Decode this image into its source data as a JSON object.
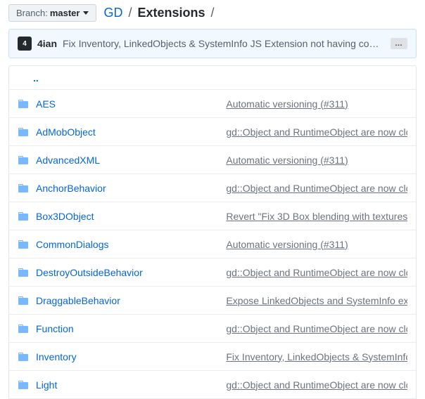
{
  "branch": {
    "label": "Branch:",
    "name": "master"
  },
  "breadcrumb": {
    "root": "GD",
    "current": "Extensions",
    "sep": "/"
  },
  "commit": {
    "author": "4ian",
    "avatar_letter": "4",
    "message": "Fix Inventory, LinkedObjects & SystemInfo JS Extension not having com…",
    "expand": "…"
  },
  "updir": "..",
  "files": [
    {
      "name": "AES",
      "msg": "Automatic versioning (#311)"
    },
    {
      "name": "AdMobObject",
      "msg": "gd::Object and RuntimeObject are now clo"
    },
    {
      "name": "AdvancedXML",
      "msg": "Automatic versioning (#311)"
    },
    {
      "name": "AnchorBehavior",
      "msg": "gd::Object and RuntimeObject are now clo"
    },
    {
      "name": "Box3DObject",
      "msg": "Revert \"Fix 3D Box blending with textures"
    },
    {
      "name": "CommonDialogs",
      "msg": "Automatic versioning (#311)"
    },
    {
      "name": "DestroyOutsideBehavior",
      "msg": "gd::Object and RuntimeObject are now clo"
    },
    {
      "name": "DraggableBehavior",
      "msg": "Expose LinkedObjects and SystemInfo ext"
    },
    {
      "name": "Function",
      "msg": "gd::Object and RuntimeObject are now clo"
    },
    {
      "name": "Inventory",
      "msg": "Fix Inventory, LinkedObjects & SystemInfo"
    },
    {
      "name": "Light",
      "msg": "gd::Object and RuntimeObject are now clo"
    }
  ]
}
